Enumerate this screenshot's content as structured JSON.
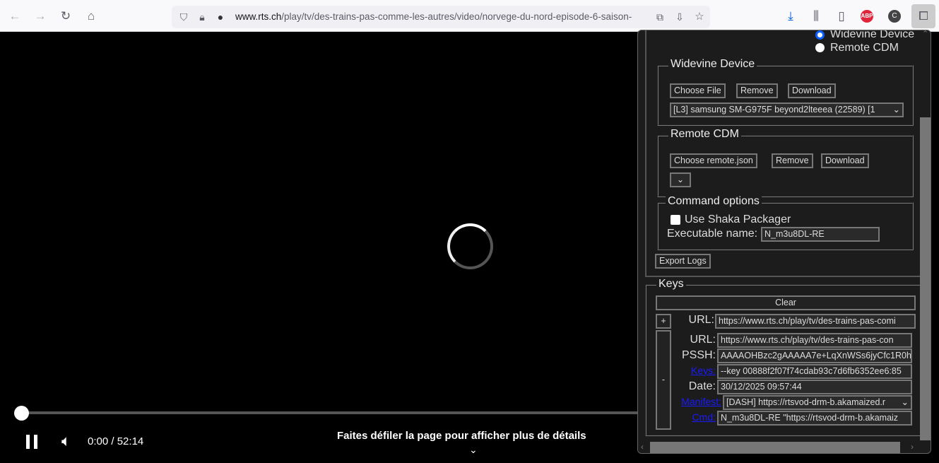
{
  "browser": {
    "url_domain": "www.rts.ch",
    "url_path": "/play/tv/des-trains-pas-comme-les-autres/video/norvege-du-nord-episode-6-saison-"
  },
  "player": {
    "current_time": "0:00",
    "separator": "/",
    "duration": "52:14",
    "scroll_hint": "Faites défiler la page pour afficher plus de détails",
    "progress": 0
  },
  "panel": {
    "cdm_options": [
      "Widevine Device",
      "Remote CDM"
    ],
    "widevine": {
      "legend": "Widevine Device",
      "choose": "Choose File",
      "remove": "Remove",
      "download": "Download",
      "selected_device": "[L3] samsung SM-G975F beyond2lteeea (22589) [1"
    },
    "remote": {
      "legend": "Remote CDM",
      "choose": "Choose remote.json",
      "remove": "Remove",
      "download": "Download"
    },
    "command": {
      "legend": "Command options",
      "shaka_label": "Use Shaka Packager",
      "exe_label": "Executable name:",
      "exe_value": "N_m3u8DL-RE"
    },
    "export_logs": "Export Logs",
    "keys": {
      "legend": "Keys",
      "clear": "Clear",
      "plus": "+",
      "minus": "-",
      "top_url_label": "URL:",
      "top_url": "https://www.rts.ch/play/tv/des-trains-pas-comi",
      "entry": {
        "url_label": "URL:",
        "url": "https://www.rts.ch/play/tv/des-trains-pas-con",
        "pssh_label": "PSSH:",
        "pssh": "AAAAOHBzc2gAAAAA7e+LqXnWSs6jyCfc1R0h",
        "keys_label": "Keys:",
        "keys": "--key 00888f2f07f74cdab93c7d6fb6352ee6:85",
        "date_label": "Date:",
        "date": "30/12/2025 09:57:44",
        "manifest_label": "Manifest:",
        "manifest": "[DASH] https://rtsvod-drm-b.akamaized.r",
        "cmd_label": "Cmd:",
        "cmd": "N_m3u8DL-RE \"https://rtsvod-drm-b.akamaiz"
      }
    }
  }
}
